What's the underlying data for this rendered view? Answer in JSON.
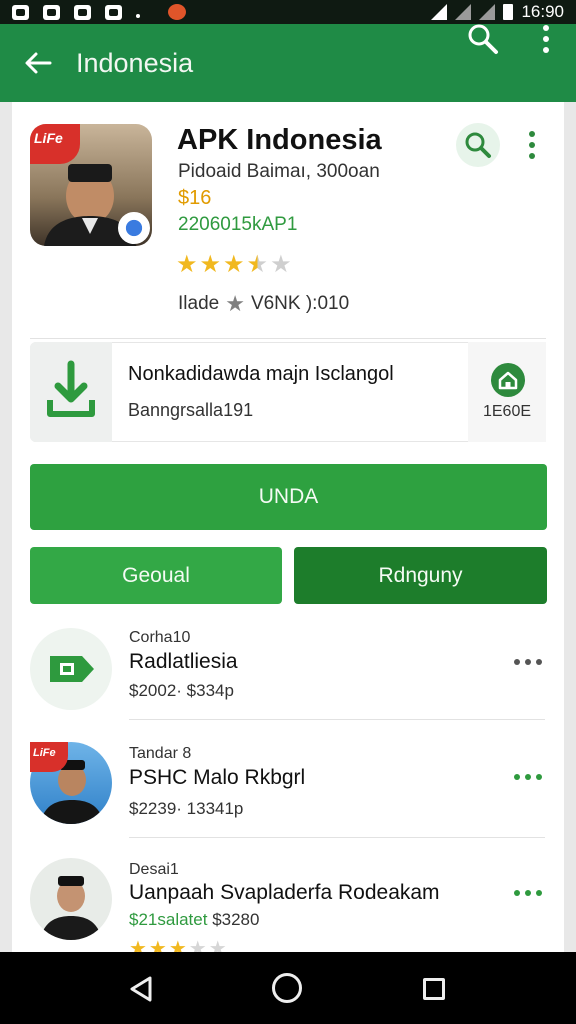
{
  "status_bar": {
    "time": "16:90"
  },
  "app_bar": {
    "title": "Indonesia"
  },
  "app": {
    "title": "APK Indonesia",
    "developer": "Pidoaid Baimaı, 300oan",
    "price": "$16",
    "code": "2206015kAP1",
    "rating_stars": 3.5,
    "rating_max": 5,
    "meta_left": "Ilade",
    "meta_right": "V6NK ):010",
    "icon_badge": "LiFe"
  },
  "download": {
    "title": "Nonkadidawda majn Isclangol",
    "subtitle": "Banngrsalla191",
    "size": "1E60E"
  },
  "buttons": {
    "primary": "UNDA",
    "secondary_left": "Geoual",
    "secondary_right": "Rdnguny"
  },
  "list": [
    {
      "category": "Corha10",
      "title": "Radlatliesia",
      "subtitle": "$2002· $334p"
    },
    {
      "category": "Tandar 8",
      "title": "PSHC Malo Rkbgrl",
      "subtitle": "$2239· 13341p",
      "badge": "LiFe"
    },
    {
      "category": "Desai1",
      "title": "Uanpaah Svapladerfa Rodeakam",
      "subtitle_green": "$21salatet",
      "subtitle": "$3280"
    }
  ],
  "colors": {
    "primary": "#1f8b46",
    "accent": "#2ea140",
    "dark_green": "#1d7d2b",
    "price": "#e19b00"
  }
}
